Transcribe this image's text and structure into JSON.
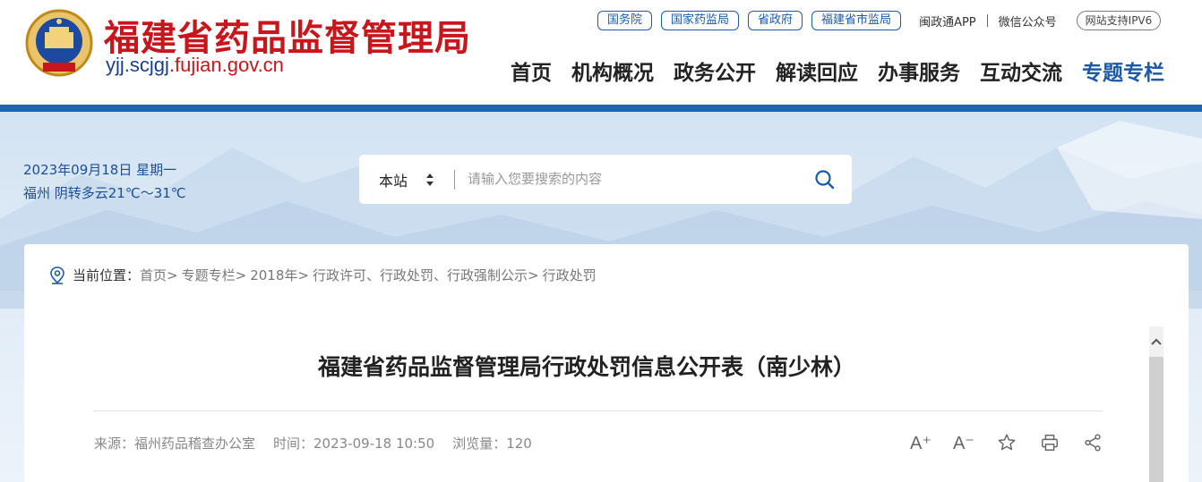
{
  "header": {
    "title": "福建省药品监督管理局",
    "domain_prefix": "yjj.scjgj",
    "domain_suffix": ".fujian.gov.cn",
    "top_links": [
      "国务院",
      "国家药监局",
      "省政府",
      "福建省市监局"
    ],
    "app_link": "闽政通APP",
    "wechat_link": "微信公众号",
    "ipv6_badge": "网站支持IPV6",
    "nav": [
      "首页",
      "机构概况",
      "政务公开",
      "解读回应",
      "办事服务",
      "互动交流",
      "专题专栏"
    ],
    "active_nav": "专题专栏",
    "colors": {
      "brand_red": "#c8161d",
      "brand_blue": "#1c5aa8",
      "bar_blue": "#1e63b6"
    }
  },
  "banner": {
    "date": "2023年09月18日 星期一",
    "weather": "福州 阴转多云21℃～31℃"
  },
  "search": {
    "scope": "本站",
    "placeholder": "请输入您要搜索的内容"
  },
  "breadcrumb": {
    "lead": "当前位置：",
    "items": [
      "首页",
      "专题专栏",
      "2018年",
      "行政许可、行政处罚、行政强制公示",
      "行政处罚"
    ]
  },
  "article": {
    "title": "福建省药品监督管理局行政处罚信息公开表（南少林）",
    "source": "来源：福州药品稽查办公室",
    "time": "时间：2023-09-18 10:50",
    "views": "浏览量：120"
  },
  "tools": {
    "font_increase": "A⁺",
    "font_decrease": "A⁻",
    "icons": [
      "font-increase-icon",
      "font-decrease-icon",
      "star-icon",
      "print-icon",
      "share-icon"
    ]
  }
}
